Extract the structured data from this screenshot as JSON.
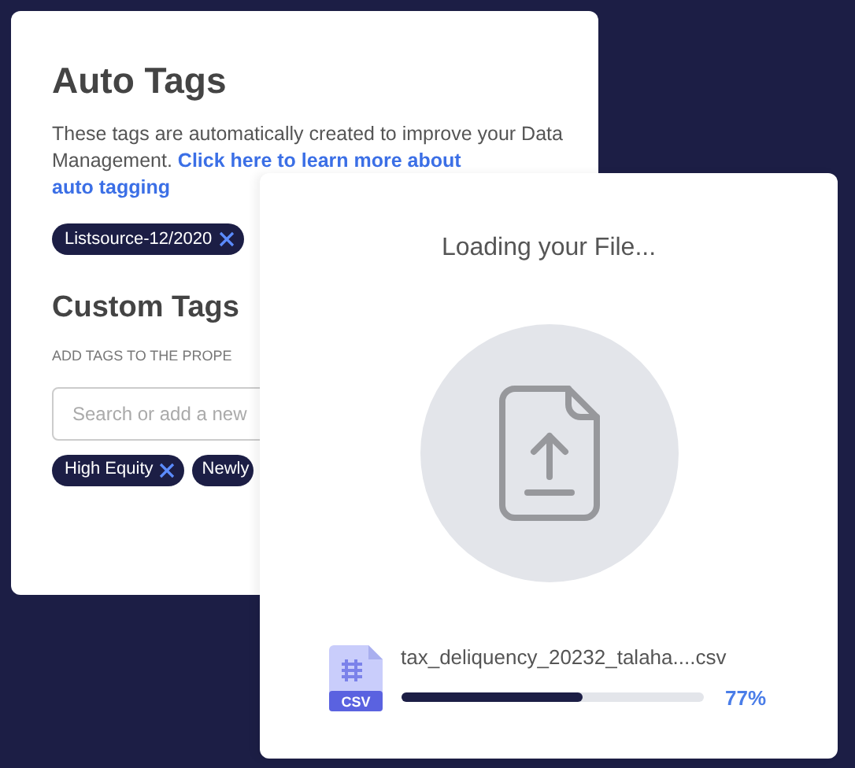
{
  "auto_tags": {
    "title": "Auto Tags",
    "description": "These tags are automatically created to improve your Data Management. ",
    "link_lines": [
      "Click here to learn more about",
      "auto tagging"
    ],
    "tags": [
      {
        "label": "Listsource-12/2020",
        "removable": true
      }
    ]
  },
  "custom_tags": {
    "title": "Custom Tags",
    "instruction": "ADD TAGS TO THE PROPE",
    "search": {
      "placeholder": "Search or add a new"
    },
    "tags": [
      {
        "label": "High Equity",
        "removable": true
      },
      {
        "label": "Newly",
        "removable": false
      }
    ]
  },
  "upload_dialog": {
    "title": "Loading your File...",
    "file": {
      "name": "tax_deliquency_20232_talaha....csv",
      "type_label": "CSV",
      "level": 0.6,
      "percent": "77%"
    }
  }
}
